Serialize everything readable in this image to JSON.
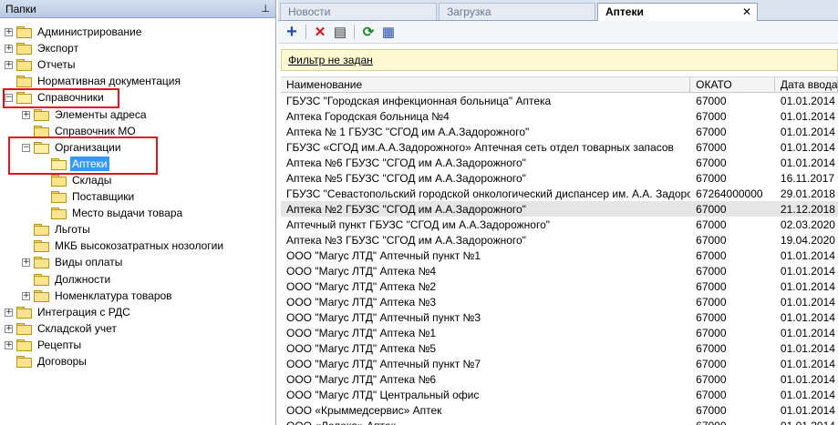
{
  "left_panel": {
    "title": "Папки",
    "pin_icon": "pin-icon",
    "tree": [
      {
        "label": "Администрирование",
        "level": 0,
        "expander": "+"
      },
      {
        "label": "Экспорт",
        "level": 0,
        "expander": "+"
      },
      {
        "label": "Отчеты",
        "level": 0,
        "expander": "+"
      },
      {
        "label": "Нормативная документация",
        "level": 0,
        "expander": ""
      },
      {
        "label": "Справочники",
        "level": 0,
        "expander": "−",
        "highlighted": true
      },
      {
        "label": "Элементы адреса",
        "level": 1,
        "expander": "+"
      },
      {
        "label": "Справочник МО",
        "level": 1,
        "expander": ""
      },
      {
        "label": "Организации",
        "level": 1,
        "expander": "−",
        "highlighted": true
      },
      {
        "label": "Аптеки",
        "level": 2,
        "expander": "",
        "selected": true
      },
      {
        "label": "Склады",
        "level": 2,
        "expander": ""
      },
      {
        "label": "Поставщики",
        "level": 2,
        "expander": ""
      },
      {
        "label": "Место выдачи товара",
        "level": 2,
        "expander": ""
      },
      {
        "label": "Льготы",
        "level": 1,
        "expander": ""
      },
      {
        "label": "МКБ высокозатратных нозологии",
        "level": 1,
        "expander": ""
      },
      {
        "label": "Виды оплаты",
        "level": 1,
        "expander": "+"
      },
      {
        "label": "Должности",
        "level": 1,
        "expander": ""
      },
      {
        "label": "Номенклатура товаров",
        "level": 1,
        "expander": "+"
      },
      {
        "label": "Интеграция с РДС",
        "level": 0,
        "expander": "+"
      },
      {
        "label": "Складской учет",
        "level": 0,
        "expander": "+"
      },
      {
        "label": "Рецепты",
        "level": 0,
        "expander": "+"
      },
      {
        "label": "Договоры",
        "level": 0,
        "expander": ""
      }
    ]
  },
  "tabs": [
    {
      "label": "Новости",
      "active": false
    },
    {
      "label": "Загрузка",
      "active": false
    },
    {
      "label": "Аптеки",
      "active": true,
      "close": "✕"
    }
  ],
  "toolbar": {
    "buttons": [
      {
        "icon": "add-icon",
        "glyph": "+"
      },
      {
        "icon": "delete-icon",
        "glyph": "✕"
      },
      {
        "icon": "properties-icon",
        "glyph": "▤"
      },
      {
        "icon": "refresh-icon",
        "glyph": "⟳"
      },
      {
        "icon": "export-icon",
        "glyph": "▦"
      }
    ]
  },
  "filter": {
    "label": "Фильтр не задан"
  },
  "grid": {
    "columns": [
      "Наименование",
      "ОКАТО",
      "Дата ввода"
    ],
    "rows": [
      [
        "ГБУЗС \"Городская инфекционная больница\" Аптека",
        "67000",
        "01.01.2014"
      ],
      [
        "Аптека Городская больница №4",
        "67000",
        "01.01.2014"
      ],
      [
        "Аптека № 1 ГБУЗС \"СГОД им А.А.Задорожного\"",
        "67000",
        "01.01.2014"
      ],
      [
        "ГБУЗС «СГОД им.А.А.Задорожного» Аптечная сеть отдел товарных запасов",
        "67000",
        "01.01.2014"
      ],
      [
        "Аптека №6  ГБУЗС \"СГОД им А.А.Задорожного\"",
        "67000",
        "01.01.2014"
      ],
      [
        "Аптека №5  ГБУЗС \"СГОД им А.А.Задорожного\"",
        "67000",
        "16.11.2017"
      ],
      [
        "ГБУЗС \"Севастопольский городской онкологический диспансер им. А.А. Задорожно...",
        "67264000000",
        "29.01.2018"
      ],
      [
        "Аптека №2  ГБУЗС \"СГОД им А.А.Задорожного\"",
        "67000",
        "21.12.2018"
      ],
      [
        "Аптечный пункт ГБУЗС \"СГОД им А.А.Задорожного\"",
        "67000",
        "02.03.2020"
      ],
      [
        "Аптека №3 ГБУЗС \"СГОД им А.А.Задорожного\"",
        "67000",
        "19.04.2020"
      ],
      [
        "ООО \"Магус ЛТД\" Аптечный пункт №1",
        "67000",
        "01.01.2014"
      ],
      [
        "ООО \"Магус ЛТД\" Аптека №4",
        "67000",
        "01.01.2014"
      ],
      [
        "ООО \"Магус ЛТД\" Аптека №2",
        "67000",
        "01.01.2014"
      ],
      [
        "ООО \"Магус ЛТД\" Аптека №3",
        "67000",
        "01.01.2014"
      ],
      [
        "ООО \"Магус ЛТД\" Аптечный пункт №3",
        "67000",
        "01.01.2014"
      ],
      [
        "ООО \"Магус ЛТД\" Аптека №1",
        "67000",
        "01.01.2014"
      ],
      [
        "ООО \"Магус ЛТД\" Аптека №5",
        "67000",
        "01.01.2014"
      ],
      [
        "ООО \"Магус ЛТД\" Аптечный пункт №7",
        "67000",
        "01.01.2014"
      ],
      [
        "ООО \"Магус ЛТД\" Аптека №6",
        "67000",
        "01.01.2014"
      ],
      [
        "ООО \"Магус ЛТД\" Центральный офис",
        "67000",
        "01.01.2014"
      ],
      [
        "ООО «Крыммедсервис» Аптек",
        "67000",
        "01.01.2014"
      ],
      [
        "ООО «Лелека» Аптек",
        "67000",
        "01.01.2014"
      ]
    ],
    "highlight_row": 7
  },
  "colors": {
    "selection": "#3399ff",
    "annotation_box": "#e0141e",
    "filter_bg": "#fffad1"
  }
}
